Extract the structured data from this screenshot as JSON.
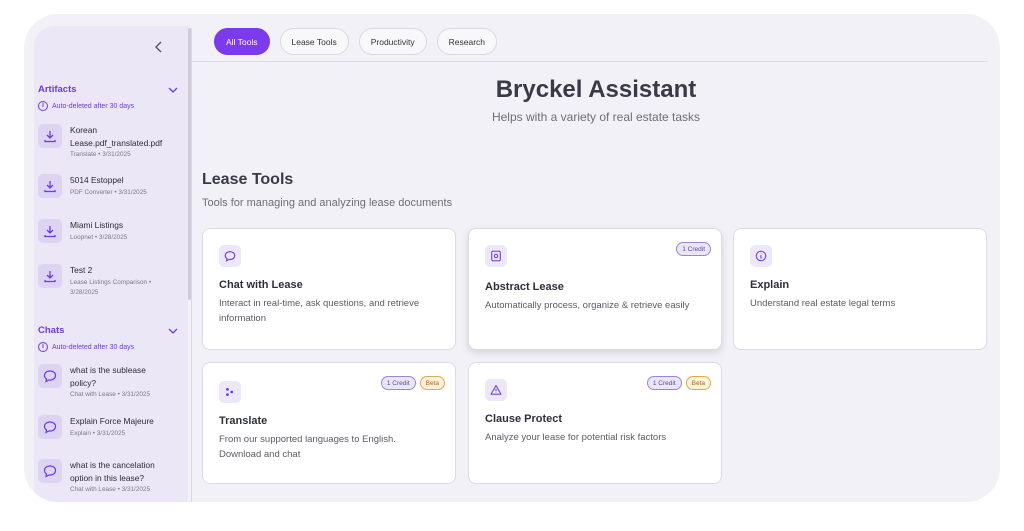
{
  "tabs": [
    {
      "label": "All Tools",
      "active": true
    },
    {
      "label": "Lease Tools",
      "active": false
    },
    {
      "label": "Productivity",
      "active": false
    },
    {
      "label": "Research",
      "active": false
    }
  ],
  "hero": {
    "title": "Bryckel Assistant",
    "subtitle": "Helps with a variety of real estate tasks"
  },
  "section": {
    "title": "Lease Tools",
    "subtitle": "Tools for managing and analyzing lease documents"
  },
  "sidebar": {
    "artifacts": {
      "title": "Artifacts",
      "note": "Auto-deleted after 30 days",
      "items": [
        {
          "name_line1": "Korean",
          "name_line2": "Lease.pdf_translated.pdf",
          "meta": "Translate • 3/31/2025",
          "icon": "download-icon"
        },
        {
          "name_line1": "5014 Estoppel",
          "meta": "PDF Converter • 3/31/2025",
          "icon": "download-icon"
        },
        {
          "name_line1": "Miami Listings",
          "meta": "Loopnet • 3/28/2025",
          "icon": "download-icon"
        },
        {
          "name_line1": "Test 2",
          "meta_line1": "Lease Listings Comparison •",
          "meta_line2": "3/28/2025",
          "icon": "download-icon"
        }
      ]
    },
    "chats": {
      "title": "Chats",
      "note": "Auto-deleted after 30 days",
      "items": [
        {
          "name_line1": "what is the sublease",
          "name_line2": "policy?",
          "meta": "Chat with Lease • 3/31/2025",
          "icon": "chat-bubble-icon"
        },
        {
          "name_line1": "Explain Force Majeure",
          "meta": "Explain • 3/31/2025",
          "icon": "chat-bubble-icon"
        },
        {
          "name_line1": "what is the cancelation",
          "name_line2": "option in this lease?",
          "meta": "Chat with Lease • 3/31/2025",
          "icon": "chat-bubble-icon"
        }
      ]
    }
  },
  "cards": [
    {
      "title": "Chat with Lease",
      "desc_line1": "Interact in real-time, ask questions, and retrieve",
      "desc_line2": "information",
      "icon": "chat-bubble-icon"
    },
    {
      "title": "Abstract Lease",
      "desc_line1": "Automatically process, organize & retrieve easily",
      "credit": "1 Credit",
      "icon": "document-settings-icon"
    },
    {
      "title": "Explain",
      "desc_line1": "Understand real estate legal terms",
      "icon": "info-icon"
    },
    {
      "title": "Translate",
      "desc_line1": "From our supported languages to English.",
      "desc_line2": "Download and chat",
      "credit": "1 Credit",
      "beta": "Beta",
      "icon": "translate-icon"
    },
    {
      "title": "Clause Protect",
      "desc_line1": "Analyze your lease for potential risk factors",
      "credit": "1 Credit",
      "beta": "Beta",
      "icon": "warning-icon"
    }
  ],
  "colors": {
    "accent": "#7c3aed",
    "sidebar_bg": "#ece7f7",
    "credit_border": "#9a86d4",
    "beta_border": "#e2a948"
  }
}
